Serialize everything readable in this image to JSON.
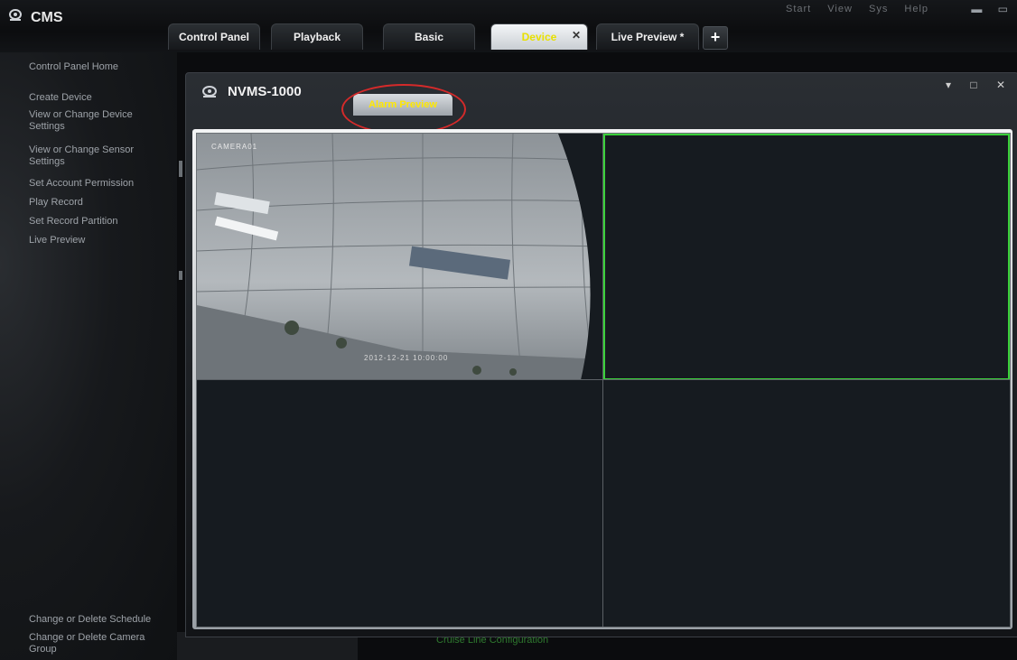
{
  "app": {
    "title": "CMS"
  },
  "menu": {
    "items": [
      "Start",
      "View",
      "Sys",
      "Help"
    ]
  },
  "tabs": [
    {
      "label": "Control Panel"
    },
    {
      "label": "Playback"
    },
    {
      "label": "Basic"
    },
    {
      "label": "Device",
      "active": true
    },
    {
      "label": "Live Preview *"
    }
  ],
  "tab_add": {
    "label": "+"
  },
  "sidebar": {
    "items": [
      {
        "label": "Control Panel Home"
      },
      {
        "label": "Create Device"
      },
      {
        "label": "View or Change Device Settings"
      },
      {
        "label": "View or Change Sensor Settings"
      },
      {
        "label": "Set Account Permission"
      },
      {
        "label": "Play Record"
      },
      {
        "label": "Set Record Partition"
      },
      {
        "label": "Live Preview"
      },
      {
        "label": "Change or Delete Schedule"
      },
      {
        "label": "Change or Delete Camera Group"
      }
    ]
  },
  "dialog": {
    "title": "NVMS-1000",
    "tab": "Alarm Preview",
    "controls": {
      "dropdown": "▾",
      "maximize": "□",
      "close": "✕"
    }
  },
  "video": {
    "camera_label": "CAMERA01",
    "timestamp": "2012-12-21 10:00:00",
    "selected_cell": 2
  },
  "footer": {
    "text": "Cruise Line Configuration"
  },
  "colors": {
    "active_tab_text": "#ffe800",
    "selected_border": "#3bd13b",
    "highlight_ring": "#d42a2a"
  }
}
